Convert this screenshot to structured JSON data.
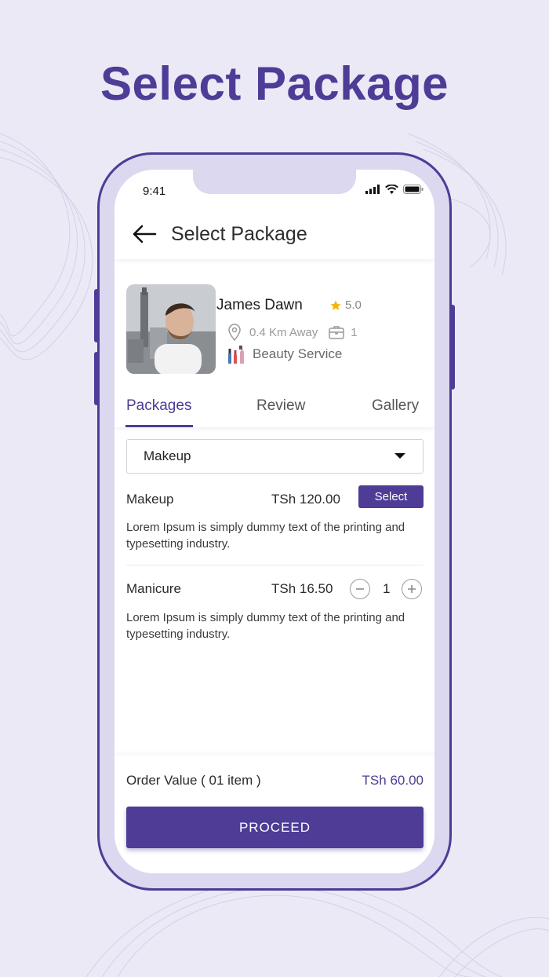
{
  "headline": "Select Package",
  "status_bar": {
    "time": "9:41"
  },
  "appbar": {
    "title": "Select Package"
  },
  "provider": {
    "name": "James Dawn",
    "rating": "5.0",
    "distance": "0.4 Km Away",
    "jobs": "1",
    "service": "Beauty Service"
  },
  "tabs": [
    {
      "label": "Packages",
      "active": true
    },
    {
      "label": "Review",
      "active": false
    },
    {
      "label": "Gallery",
      "active": false
    }
  ],
  "category_select": {
    "value": "Makeup"
  },
  "packages": [
    {
      "name": "Makeup",
      "price": "TSh 120.00",
      "action_label": "Select",
      "description": "Lorem Ipsum is simply dummy text of the printing and typesetting industry."
    },
    {
      "name": "Manicure",
      "price": "TSh 16.50",
      "quantity": "1",
      "description": "Lorem Ipsum is simply dummy text of the printing and typesetting industry."
    }
  ],
  "footer": {
    "order_label": "Order Value ( 01 item )",
    "order_value": "TSh 60.00",
    "proceed_label": "PROCEED"
  },
  "colors": {
    "brand": "#4e3c97",
    "background": "#ebe9f5",
    "star": "#f7b500"
  },
  "icons": [
    "back-arrow-icon",
    "star-icon",
    "location-pin-icon",
    "briefcase-icon",
    "beauty-tools-icon",
    "dropdown-caret-icon",
    "minus-icon",
    "plus-icon",
    "signal-icon",
    "wifi-icon",
    "battery-icon"
  ]
}
